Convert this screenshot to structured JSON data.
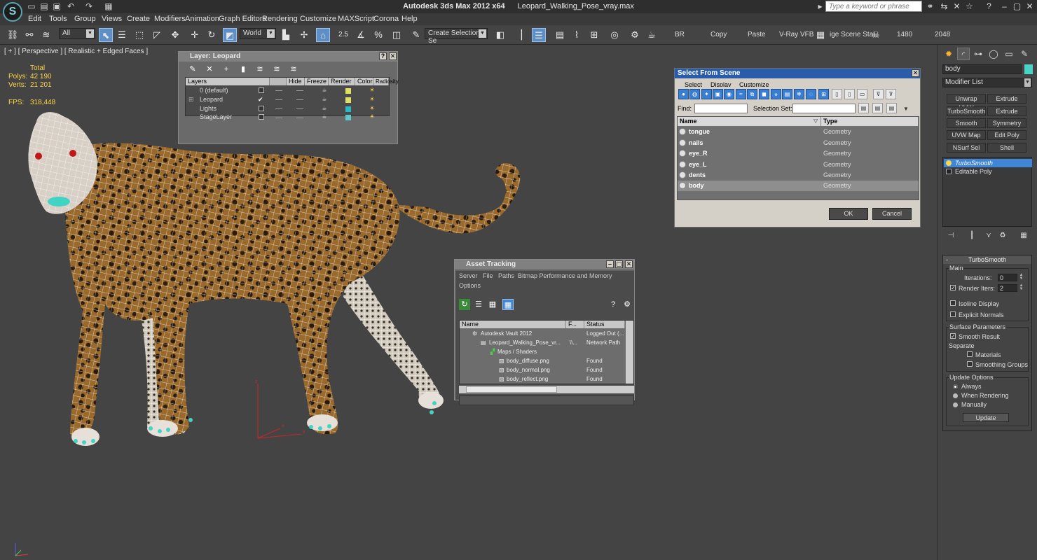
{
  "titlebar": {
    "app": "Autodesk 3ds Max  2012 x64",
    "file": "Leopard_Walking_Pose_vray.max",
    "search_placeholder": "Type a keyword or phrase"
  },
  "menus": [
    "Edit",
    "Tools",
    "Group",
    "Views",
    "Create",
    "Modifiers",
    "Animation",
    "Graph Editors",
    "Rendering",
    "Customize",
    "MAXScript",
    "Corona",
    "Help"
  ],
  "toolbar": {
    "filter_value": "All",
    "coord_value": "World",
    "snap_value": "2.5",
    "selection_set_value": "Create Selection Se",
    "br_label": "BR",
    "copy_label": "Copy",
    "paste_label": "Paste",
    "vfb_label": "V-Ray VFB",
    "scene_label": "ige Scene Sta!",
    "width_value": "1480",
    "height_value": "2048"
  },
  "viewport": {
    "label": "[ + ] [ Perspective ] [ Realistic + Edged Faces ]",
    "total_label": "Total",
    "polys_label": "Polys:",
    "polys_value": "42 190",
    "verts_label": "Verts:",
    "verts_value": "21 201",
    "fps_label": "FPS:",
    "fps_value": "318,448"
  },
  "layer_dialog": {
    "title": "Layer: Leopard",
    "columns": [
      "Layers",
      "Hide",
      "Freeze",
      "Render",
      "Color",
      "Radiosity"
    ],
    "layers": [
      {
        "name": "0 (default)",
        "color": "#e0e060"
      },
      {
        "name": "Leopard",
        "color": "#e0e060"
      },
      {
        "name": "Lights",
        "color": "#2ab7c6"
      },
      {
        "name": "StageLayer",
        "color": "#5fc8c8"
      }
    ]
  },
  "select_dialog": {
    "title": "Select From Scene",
    "menus": [
      "Select",
      "Display",
      "Customize"
    ],
    "find_label": "Find:",
    "selset_label": "Selection Set:",
    "col_name": "Name",
    "col_type": "Type",
    "rows": [
      {
        "name": "tongue",
        "type": "Geometry"
      },
      {
        "name": "nails",
        "type": "Geometry"
      },
      {
        "name": "eye_R",
        "type": "Geometry"
      },
      {
        "name": "eye_L",
        "type": "Geometry"
      },
      {
        "name": "dents",
        "type": "Geometry"
      },
      {
        "name": "body",
        "type": "Geometry"
      }
    ],
    "ok_label": "OK",
    "cancel_label": "Cancel"
  },
  "asset_dialog": {
    "title": "Asset Tracking",
    "menus": [
      "Server",
      "File",
      "Paths",
      "Bitmap Performance and Memory"
    ],
    "menus2": [
      "Options"
    ],
    "col_name": "Name",
    "col_f": "F...",
    "col_status": "Status",
    "rows": [
      {
        "name": "Autodesk Vault 2012",
        "f": "",
        "status": "Logged Out (..."
      },
      {
        "name": "Leopard_Walking_Pose_vr...",
        "f": "\\\\...",
        "status": "Network Path"
      },
      {
        "name": "Maps / Shaders",
        "f": "",
        "status": ""
      },
      {
        "name": "body_diffuse.png",
        "f": "",
        "status": "Found"
      },
      {
        "name": "body_normal.png",
        "f": "",
        "status": "Found"
      },
      {
        "name": "body_reflect.png",
        "f": "",
        "status": "Found"
      }
    ]
  },
  "command_panel": {
    "object_name": "body",
    "object_color": "#4ad2c4",
    "modifier_list": "Modifier List",
    "mod_buttons": [
      "Unwrap UVW",
      "Extrude",
      "TurboSmooth",
      "Extrude",
      "Smooth",
      "Symmetry",
      "UVW Map",
      "Edit Poly",
      "NSurf Sel",
      "Shell"
    ],
    "stack": [
      "TurboSmooth",
      "Editable Poly"
    ],
    "rollout_title": "TurboSmooth",
    "main_label": "Main",
    "iterations_label": "Iterations:",
    "iterations_value": "0",
    "render_iters_label": "Render Iters:",
    "render_iters_value": "2",
    "isoline_label": "Isoline Display",
    "explicit_label": "Explicit Normals",
    "surface_label": "Surface Parameters",
    "smooth_result_label": "Smooth Result",
    "separate_label": "Separate",
    "materials_label": "Materials",
    "smoothing_groups_label": "Smoothing Groups",
    "update_options_label": "Update Options",
    "always_label": "Always",
    "when_rendering_label": "When Rendering",
    "manually_label": "Manually",
    "update_button": "Update"
  }
}
